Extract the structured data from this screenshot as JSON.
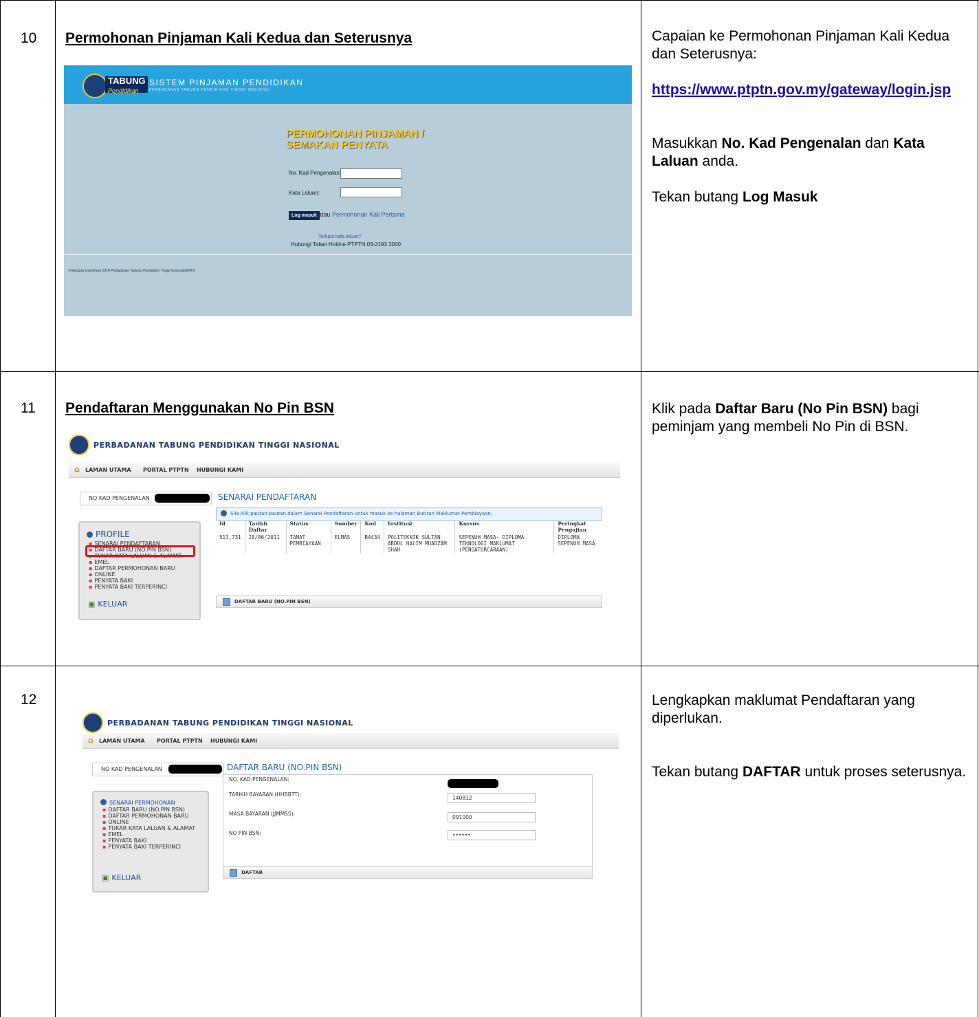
{
  "rows": [
    {
      "num": "10",
      "title": "Permohonan Pinjaman Kali Kedua dan Seterusnya",
      "right": {
        "p1": "Capaian ke Permohonan Pinjaman Kali Kedua dan Seterusnya:",
        "link": "https://www.ptptn.gov.my/gateway/login.jsp",
        "p3_a": "Masukkan ",
        "p3_b": "No. Kad Pengenalan",
        "p3_c": " dan ",
        "p3_d": "Kata Laluan",
        "p3_e": " anda.",
        "p4_a": "Tekan butang ",
        "p4_b": "Log Masuk"
      },
      "screen": {
        "tab_main": "TABUNG",
        "tab_sub": "Pendidikan",
        "system": "SISTEM PINJAMAN PENDIDIKAN",
        "subtitle": "PERBADANAN TABUNG PENDIDIKAN TINGGI NASIONAL",
        "heading_1": "PERMOHONAN PINJAMAN /",
        "heading_2": "SEMAKAN PENYATA",
        "label_ic": "No. Kad Pengenalan:",
        "label_pw": "Kata Laluan:",
        "login_button": "Log masuk",
        "atau": "atau ",
        "first_app_link": "Permohonan Kali Pertama",
        "forgot": "Terlupa kata laluan?",
        "hotline": "Hubungi Talian Hotline PTPTN 03-2193 3000",
        "copyright": "©Hakcipta terpelihara 2018 Perbadanan Tabung Pendidikan Tinggi Nasional@MP3"
      }
    },
    {
      "num": "11",
      "title": "Pendaftaran Menggunakan No Pin BSN",
      "right": {
        "a": "Klik pada ",
        "b": "Daftar Baru (No Pin BSN)",
        "c": " bagi peminjam yang membeli No Pin di BSN."
      },
      "screen": {
        "brand": "PERBADANAN TABUNG PENDIDIKAN TINGGI NASIONAL",
        "nav": [
          "LAMAN UTAMA",
          "PORTAL PTPTN",
          "HUBUNGI KAMI"
        ],
        "kad_label": "NO KAD PENGENALAN",
        "section": "SENARAI PENDAFTARAN",
        "info": "Sila klik pautan-pautan dalam Senarai Pendaftaran untuk masuk ke halaman Butiran Maklumat Pembiayaan.",
        "side_head": "PROFILE",
        "side_items": [
          "SENARAI PENDAFTARAN",
          "DAFTAR BARU (NO.PIN BSN)",
          "TUKAR KATA LALUAN & ALAMAT",
          "EMEL",
          "DAFTAR PERMOHONAN BARU",
          "ONLINE",
          "PENYATA BAKI",
          "PENYATA BAKI TERPERINCI"
        ],
        "keluar": "KELUAR",
        "columns": [
          "Id",
          "Tarikh Daftar",
          "Status",
          "Sumber",
          "Kod",
          "Institusi",
          "Kursus",
          "Peringkat Pengajian"
        ],
        "row": [
          "513,731",
          "28/06/2011",
          "TAMAT PEMBIAYAAN",
          "ELMAS",
          "B4434",
          "POLITEKNIK SULTAN ABDUL HALIM MUADZAM SHAH",
          "SEPENUH MASA- DIPLOMA TEKNOLOGI MAKLUMAT (PENGATURCARAAN)",
          "DIPLOMA SEPENUH MASA"
        ],
        "bar": "DAFTAR BARU (NO.PIN BSN)"
      }
    },
    {
      "num": "12",
      "right": {
        "p1": "Lengkapkan maklumat Pendaftaran yang diperlukan.",
        "p2_a": "Tekan butang ",
        "p2_b": "DAFTAR",
        "p2_c": " untuk proses seterusnya."
      },
      "screen": {
        "brand": "PERBADANAN TABUNG PENDIDIKAN TINGGI NASIONAL",
        "nav": [
          "LAMAN UTAMA",
          "PORTAL PTPTN",
          "HUBUNGI KAMI"
        ],
        "kad_label": "NO KAD PENGENALAN",
        "section": "DAFTAR BARU (NO.PIN BSN)",
        "side_head": "SENARAI PERMOHONAN",
        "side_items": [
          "DAFTAR BARU (NO.PIN BSN)",
          "DAFTAR PERMOHONAN BARU",
          "ONLINE",
          "TUKAR KATA LALUAN & ALAMAT",
          "EMEL",
          "PENYATA BAKI",
          "PENYATA BAKI TERPERINCI"
        ],
        "keluar": "KELUAR",
        "f_ic": "NO. KAD PENGENALAN:",
        "f_date": "TARIKH BAYARAN (HHBBTT):",
        "f_date_val": "140812",
        "f_time": "MASA BAYARAN (JJMMSS):",
        "f_time_val": "091000",
        "f_pin": "NO PIN BSN:",
        "f_pin_val": "••••••",
        "bar": "DAFTAR"
      }
    }
  ]
}
